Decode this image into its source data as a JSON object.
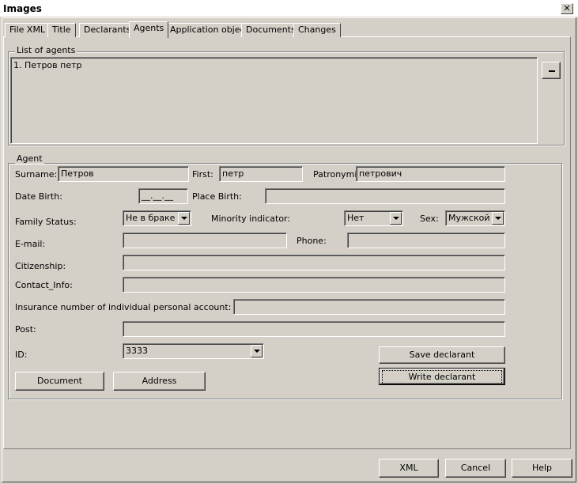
{
  "window": {
    "title": "Images",
    "close_glyph": "✕"
  },
  "tabs": [
    {
      "label": "File XML"
    },
    {
      "label": "Title"
    },
    {
      "label": "Declarants"
    },
    {
      "label": "Agents"
    },
    {
      "label": "Application object"
    },
    {
      "label": "Documents"
    },
    {
      "label": "Changes"
    }
  ],
  "active_tab": "Agents",
  "agents_list": {
    "label": "List of agents",
    "items": [
      "1. Петров петр"
    ]
  },
  "agent": {
    "label": "Agent",
    "surname_label": "Surname:",
    "surname_value": "Петров",
    "first_label": "First:",
    "first_value": "петр",
    "patronymic_label": "Patronymic:",
    "patronymic_value": "петрович",
    "date_birth_label": "Date Birth:",
    "date_birth_value": "__.__.__",
    "place_birth_label": "Place Birth:",
    "place_birth_value": "",
    "family_status_label": "Family Status:",
    "family_status_value": "Не в браке",
    "minority_label": "Minority indicator:",
    "minority_value": "Нет",
    "sex_label": "Sex:",
    "sex_value": "Мужской",
    "email_label": "E-mail:",
    "email_value": "",
    "phone_label": "Phone:",
    "phone_value": "",
    "citizenship_label": "Citizenship:",
    "citizenship_value": "",
    "contact_label": "Contact_Info:",
    "contact_value": "",
    "insurance_label": "Insurance number of individual personal account:",
    "insurance_value": "",
    "post_label": "Post:",
    "post_value": "",
    "id_label": "ID:",
    "id_value": "3333",
    "document_button": "Document",
    "address_button": "Address",
    "save_button": "Save declarant",
    "write_button": "Write declarant"
  },
  "footer": {
    "xml_button": "XML",
    "cancel_button": "Cancel",
    "help_button": "Help"
  }
}
